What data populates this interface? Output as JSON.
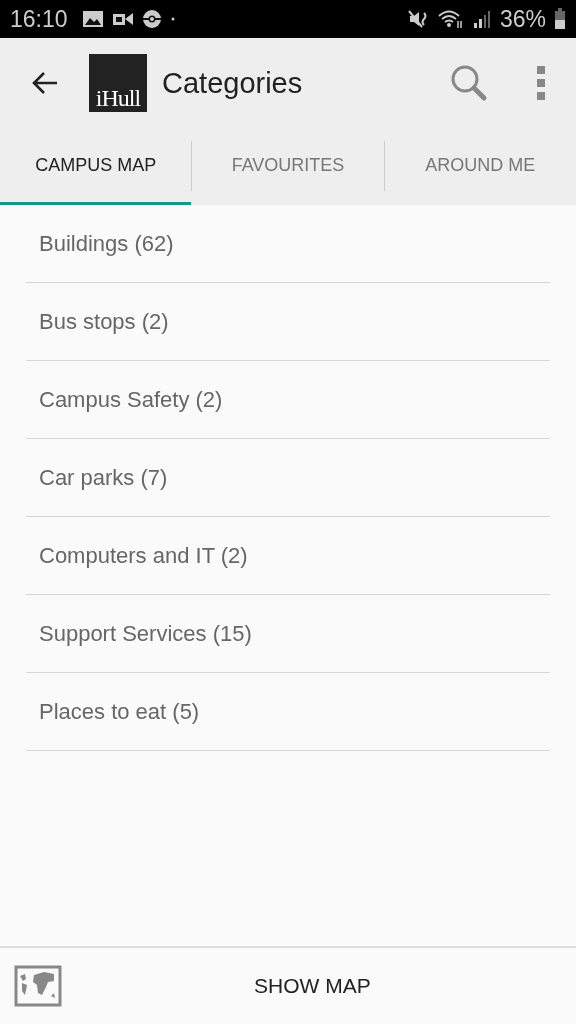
{
  "status_bar": {
    "time": "16:10",
    "battery": "36%"
  },
  "app_bar": {
    "logo": "iHull",
    "title": "Categories"
  },
  "tabs": [
    {
      "label": "CAMPUS MAP",
      "selected": true
    },
    {
      "label": "FAVOURITES",
      "selected": false
    },
    {
      "label": "AROUND ME",
      "selected": false
    }
  ],
  "categories": [
    {
      "label": "Buildings (62)"
    },
    {
      "label": "Bus stops (2)"
    },
    {
      "label": "Campus Safety (2)"
    },
    {
      "label": "Car parks (7)"
    },
    {
      "label": "Computers and IT (2)"
    },
    {
      "label": "Support Services (15)"
    },
    {
      "label": "Places to eat (5)"
    }
  ],
  "bottom_bar": {
    "button": "SHOW MAP"
  }
}
